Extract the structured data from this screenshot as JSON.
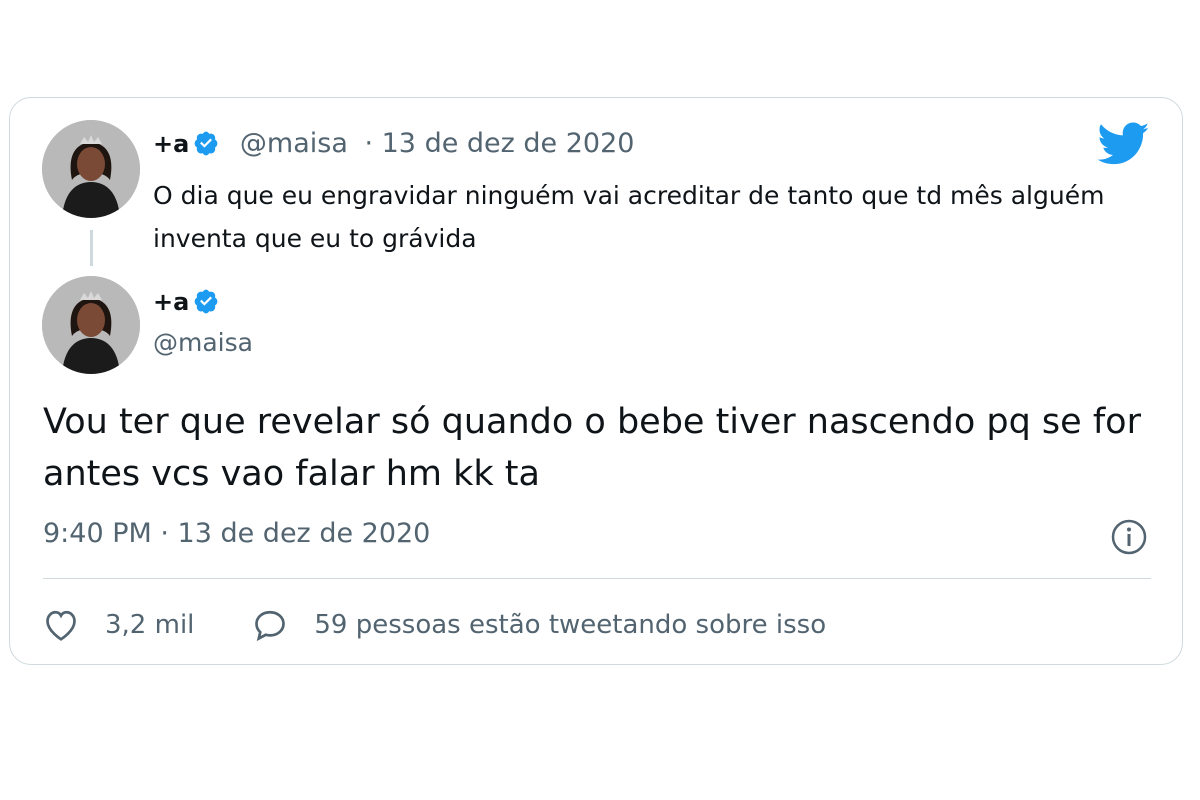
{
  "quoted_tweet": {
    "author_name": "+a",
    "handle": "@maisa",
    "date": "· 13 de dez de 2020",
    "text": "O dia que eu engravidar ninguém vai acreditar de tanto que td mês alguém inventa que eu to grávida"
  },
  "main_tweet": {
    "author_name": "+a",
    "handle": "@maisa",
    "text": "Vou ter que revelar só quando o bebe tiver nascendo pq se for antes vcs vao falar hm kk ta",
    "timestamp": "9:40 PM · 13 de dez de 2020"
  },
  "actions": {
    "likes": "3,2 mil",
    "reply_text": "59 pessoas estão tweetando sobre isso"
  },
  "icons": {
    "brand": "twitter-bird-icon",
    "verified": "verified-badge-icon",
    "info": "info-icon",
    "like": "heart-icon",
    "reply": "comment-bubble-icon"
  },
  "colors": {
    "brand_blue": "#1d9bf0",
    "text": "#0f1419",
    "muted": "#536471",
    "border": "#cfd9de"
  }
}
